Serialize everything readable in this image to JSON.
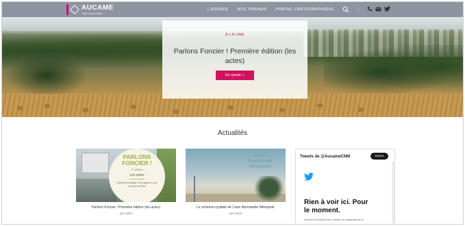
{
  "header": {
    "logo_name": "AUCAME",
    "logo_sub": "Caen Normandie",
    "nav": [
      "L'AGENCE",
      "NOS TRAVAUX",
      "PORTAIL CARTOGRAPHIQUE"
    ]
  },
  "hero": {
    "kicker": "À LA UNE",
    "title": "Parlons Foncier ! Première édition (les actes)",
    "button": "En savoir +"
  },
  "news": {
    "title": "Actualités",
    "cards": [
      {
        "image": {
          "title_line1": "PARLONS",
          "title_line2": "FONCIER !",
          "edition": "1ʳᵉ édition",
          "subtitle": "Les actes",
          "note": "Comment protéger nos nappes et nos sources de l'eau"
        },
        "caption": "Parlons Foncier ! Première édition (les actes)",
        "date": "juin 2023"
      },
      {
        "image": {
          "title_line1": "Caen",
          "title_line2": "Normandie",
          "title_line3": "Métropole"
        },
        "caption": "Le schéma cyclable de Caen Normandie Métropole",
        "date": "juin 2023"
      }
    ]
  },
  "twitter": {
    "header": "Tweets de @AucameCNM",
    "follow": "Suivre",
    "empty_line1": "Rien à voir ici. Pour",
    "empty_line2": "le moment.",
    "sub": "Quand ils publient des Tweets, ils apparaîtront ici."
  },
  "colors": {
    "accent": "#c3136e",
    "button": "#d1135f",
    "header_bg": "#8e94a2",
    "twitter_blue": "#1d9bf0"
  }
}
